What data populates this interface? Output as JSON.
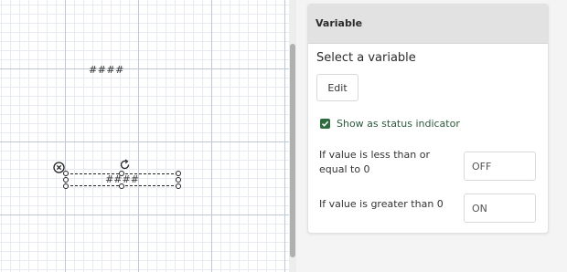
{
  "canvas": {
    "text_top": "####",
    "text_selected": "####"
  },
  "panel": {
    "title": "Variable",
    "select_label": "Select a variable",
    "edit_label": "Edit",
    "checkbox_label": "Show as status indicator",
    "checkbox_checked": true,
    "conditions": [
      {
        "label": "If value is less than or equal to 0",
        "value": "OFF"
      },
      {
        "label": "If value is greater than 0",
        "value": "ON"
      }
    ]
  },
  "colors": {
    "accent_green": "#2e6b3f",
    "header_bg": "#e2e2e2"
  }
}
